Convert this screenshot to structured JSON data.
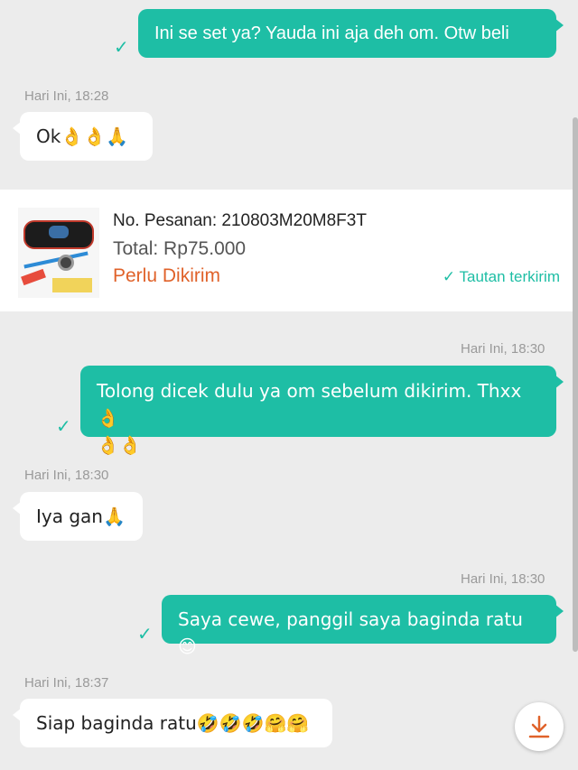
{
  "messages": [
    {
      "text": "Ini se set ya? Yauda ini aja deh om. Otw beli"
    },
    {
      "time": "Hari Ini, 18:28",
      "text": "Ok👌👌🙏"
    },
    {
      "time": "Hari Ini, 18:30",
      "text_line1": "Tolong dicek dulu ya om sebelum dikirim. Thxx👌",
      "text_line2": "👌👌"
    },
    {
      "time": "Hari Ini, 18:30",
      "text": "Iya gan🙏"
    },
    {
      "time": "Hari Ini, 18:30",
      "text": "Saya cewe, panggil saya baginda ratu 😊"
    },
    {
      "time": "Hari Ini, 18:37",
      "text": "Siap baginda ratu🤣🤣🤣🤗🤗"
    }
  ],
  "order_card": {
    "order_number": "No. Pesanan: 210803M20M8F3T",
    "total": "Total: Rp75.000",
    "status": "Perlu Dikirim",
    "link_status": "Tautan terkirim"
  },
  "icons": {
    "check": "✓",
    "scroll_down": "download-arrow-icon"
  },
  "colors": {
    "outgoing_bubble": "#1ebea5",
    "incoming_bubble": "#ffffff",
    "background": "#ececec",
    "status_orange": "#e0622a",
    "fab_arrow": "#e0622a"
  }
}
